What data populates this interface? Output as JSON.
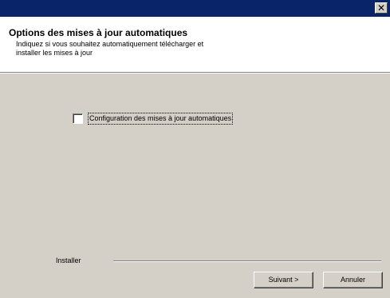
{
  "window": {
    "close_glyph": "✕"
  },
  "header": {
    "title": "Options des mises à jour automatiques",
    "subtitle": "Indiquez si vous souhaitez automatiquement télécharger et installer les mises à jour"
  },
  "option": {
    "label": "Configuration des mises à jour automatiques",
    "checked": false
  },
  "footer": {
    "brand_label": "Installer"
  },
  "buttons": {
    "next_label": "Suivant >",
    "cancel_label": "Annuler"
  },
  "colors": {
    "titlebar": "#0a246a",
    "dialog_bg": "#d4d0c8",
    "header_bg": "#ffffff"
  }
}
